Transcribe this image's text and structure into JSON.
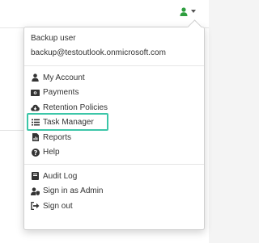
{
  "topbar": {
    "user_icon": "user-icon",
    "user_icon_color": "#2e9e3f",
    "caret_icon": "caret-down-icon"
  },
  "menu": {
    "user_name": "Backup user",
    "user_email": "backup@testoutlook.onmicrosoft.com",
    "group1": [
      {
        "label": "My Account",
        "icon": "user-icon"
      },
      {
        "label": "Payments",
        "icon": "money-bill-icon"
      },
      {
        "label": "Retention Policies",
        "icon": "cloud-download-icon"
      },
      {
        "label": "Task Manager",
        "icon": "list-icon",
        "highlighted": true
      },
      {
        "label": "Reports",
        "icon": "file-chart-icon"
      },
      {
        "label": "Help",
        "icon": "question-circle-icon"
      }
    ],
    "group2": [
      {
        "label": "Audit Log",
        "icon": "book-icon"
      },
      {
        "label": "Sign in as Admin",
        "icon": "user-shield-icon"
      },
      {
        "label": "Sign out",
        "icon": "sign-out-icon"
      }
    ],
    "highlight_color": "#3cc6a8"
  }
}
